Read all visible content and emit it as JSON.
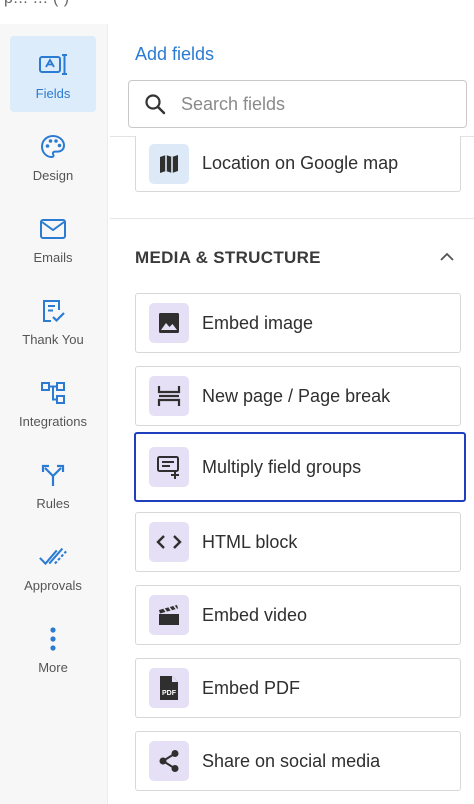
{
  "top_fragment": "p... ... ( )",
  "sidebar": {
    "items": [
      {
        "label": "Fields",
        "icon": "fields-icon",
        "active": true
      },
      {
        "label": "Design",
        "icon": "palette-icon"
      },
      {
        "label": "Emails",
        "icon": "mail-icon"
      },
      {
        "label": "Thank You",
        "icon": "thank-you-icon"
      },
      {
        "label": "Integrations",
        "icon": "integrations-icon"
      },
      {
        "label": "Rules",
        "icon": "rules-icon"
      },
      {
        "label": "Approvals",
        "icon": "approvals-icon"
      },
      {
        "label": "More",
        "icon": "more-icon"
      }
    ]
  },
  "panel": {
    "title": "Add fields",
    "search_placeholder": "Search fields",
    "partial_field": {
      "label": "Location on Google map",
      "icon": "map-icon"
    },
    "section": {
      "title": "MEDIA & STRUCTURE",
      "collapsed": false
    },
    "fields": [
      {
        "label": "Embed image",
        "icon": "image-icon"
      },
      {
        "label": "New page / Page break",
        "icon": "page-break-icon"
      },
      {
        "label": "Multiply field groups",
        "icon": "field-group-icon",
        "selected": true
      },
      {
        "label": "HTML block",
        "icon": "code-icon"
      },
      {
        "label": "Embed video",
        "icon": "video-icon"
      },
      {
        "label": "Embed PDF",
        "icon": "pdf-icon"
      },
      {
        "label": "Share on social media",
        "icon": "share-icon"
      }
    ]
  },
  "colors": {
    "accent": "#2b7bd3",
    "active_nav_bg": "#dcecfa",
    "icon_tile": "#e5e0f5",
    "selected_border": "#1f3fbf"
  }
}
